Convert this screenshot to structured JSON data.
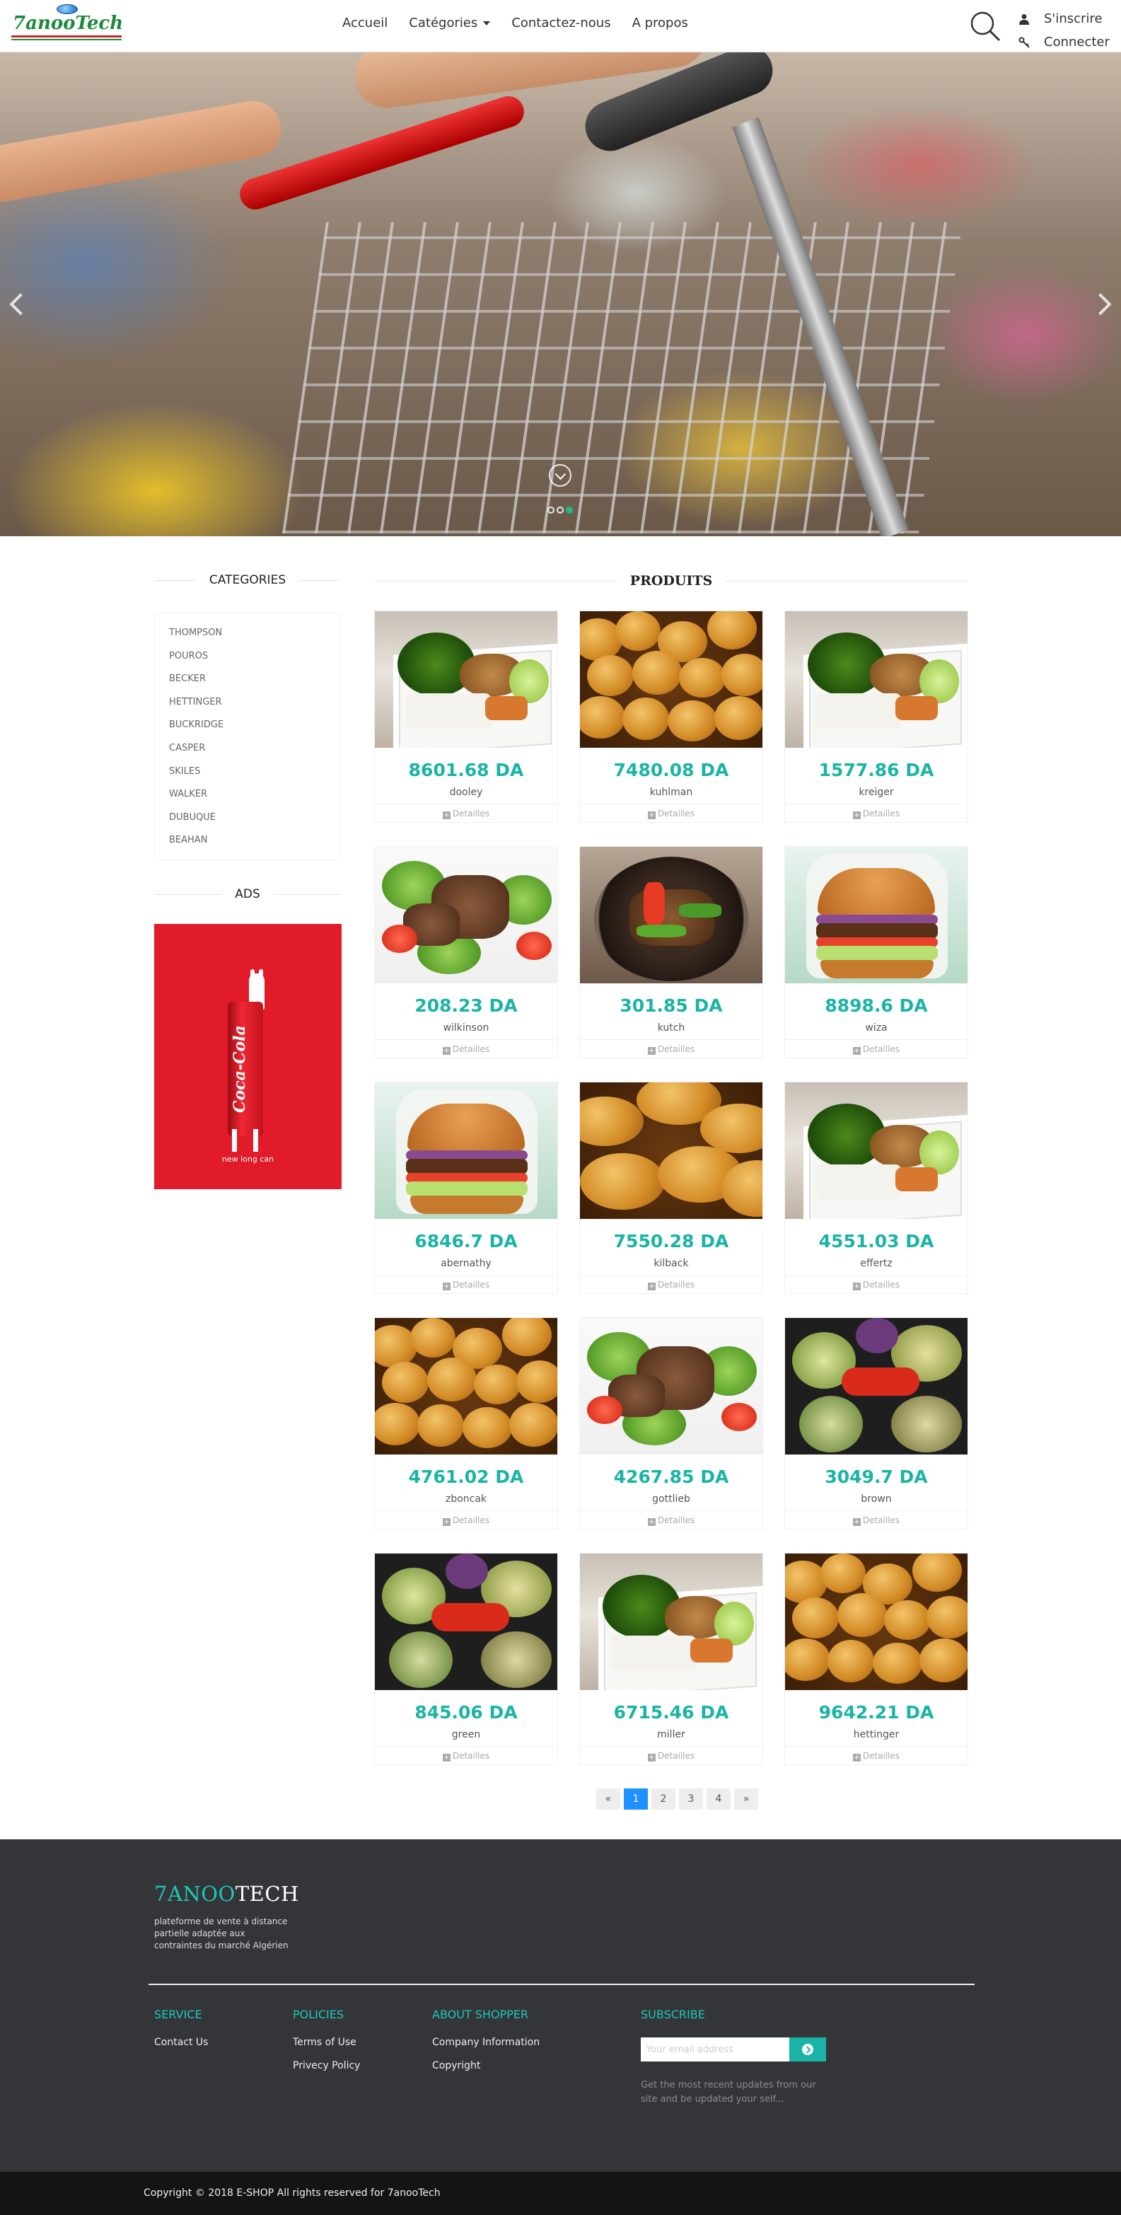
{
  "nav": {
    "logo_text": "7anooTech",
    "links": [
      "Accueil",
      "Catégories",
      "Contactez-nous",
      "A propos"
    ],
    "signup": "S'inscrire",
    "login": "Connecter"
  },
  "hero": {
    "slide_count": 3,
    "active_slide": 3
  },
  "sidebar": {
    "categories_title": "CATEGORIES",
    "categories": [
      "THOMPSON",
      "POUROS",
      "BECKER",
      "HETTINGER",
      "BUCKRIDGE",
      "CASPER",
      "SKILES",
      "WALKER",
      "DUBUQUE",
      "BEAHAN"
    ],
    "ads_title": "ADS",
    "ad_brand": "Coca-Cola",
    "ad_tagline": "new long can"
  },
  "products": {
    "title": "PRODUITS",
    "details_label": "Detailles",
    "items": [
      {
        "price": "8601.68 DA",
        "name": "dooley"
      },
      {
        "price": "7480.08 DA",
        "name": "kuhlman"
      },
      {
        "price": "1577.86 DA",
        "name": "kreiger"
      },
      {
        "price": "208.23 DA",
        "name": "wilkinson"
      },
      {
        "price": "301.85 DA",
        "name": "kutch"
      },
      {
        "price": "8898.6 DA",
        "name": "wiza"
      },
      {
        "price": "6846.7 DA",
        "name": "abernathy"
      },
      {
        "price": "7550.28 DA",
        "name": "kilback"
      },
      {
        "price": "4551.03 DA",
        "name": "effertz"
      },
      {
        "price": "4761.02 DA",
        "name": "zboncak"
      },
      {
        "price": "4267.85 DA",
        "name": "gottlieb"
      },
      {
        "price": "3049.7 DA",
        "name": "brown"
      },
      {
        "price": "845.06 DA",
        "name": "green"
      },
      {
        "price": "6715.46 DA",
        "name": "miller"
      },
      {
        "price": "9642.21 DA",
        "name": "hettinger"
      }
    ]
  },
  "pagination": {
    "prev": "«",
    "pages": [
      "1",
      "2",
      "3",
      "4"
    ],
    "next": "»",
    "current": "1"
  },
  "footer": {
    "brand_part1": "7ANOO",
    "brand_part2": "TECH",
    "description": "plateforme de vente à distance partielle adaptée aux contraintes du marché Algérien",
    "service": {
      "title": "SERVICE",
      "links": [
        "Contact Us"
      ]
    },
    "policies": {
      "title": "POLICIES",
      "links": [
        "Terms of Use",
        "Privecy Policy"
      ]
    },
    "about": {
      "title": "ABOUT SHOPPER",
      "links": [
        "Company Information",
        "Copyright"
      ]
    },
    "subscribe": {
      "title": "SUBSCRIBE",
      "placeholder": "Your email address",
      "note": "Get the most recent updates from our site and be updated your self..."
    },
    "copyright": "Copyright © 2018 E-SHOP All rights reserved for 7anooTech"
  },
  "colors": {
    "accent": "#1ab4a6",
    "footer_bg": "#333539",
    "active_page": "#1e90ff"
  }
}
